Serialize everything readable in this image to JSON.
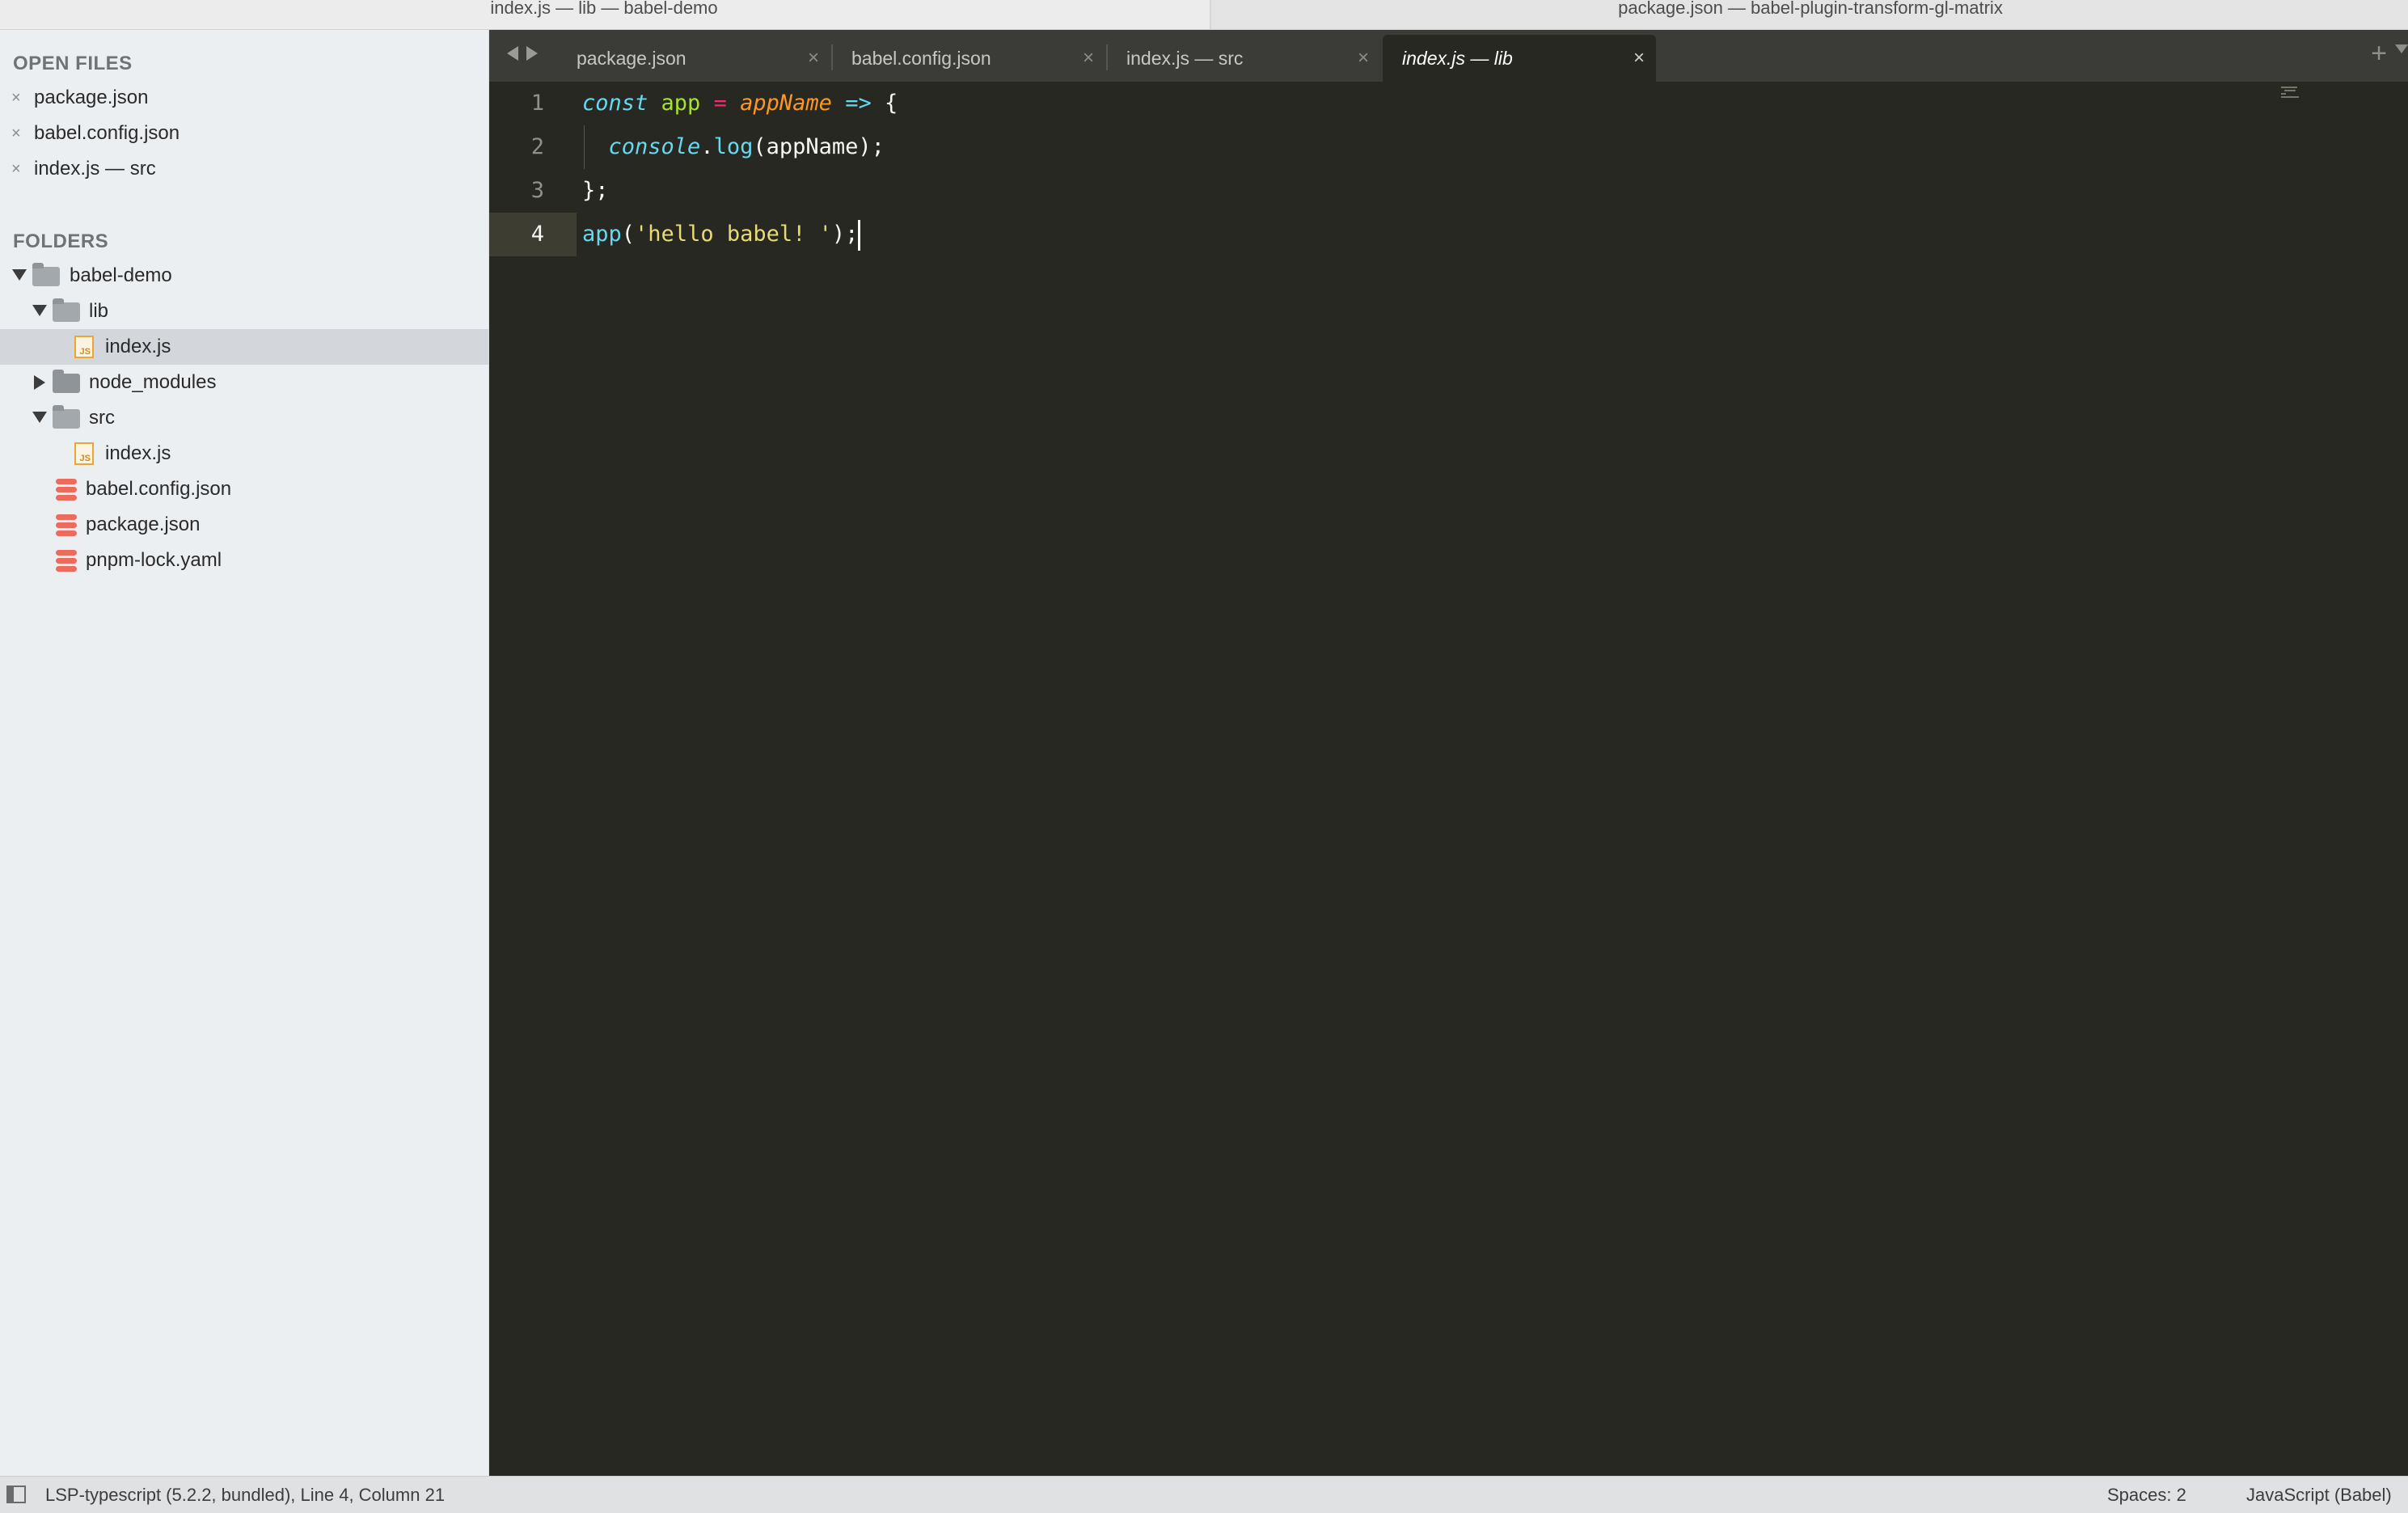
{
  "window": {
    "title_left": "index.js — lib — babel-demo",
    "title_right": "package.json — babel-plugin-transform-gl-matrix"
  },
  "sidebar": {
    "open_files_header": "OPEN FILES",
    "open_files": [
      {
        "label": "package.json",
        "close": "×"
      },
      {
        "label": "babel.config.json",
        "close": "×"
      },
      {
        "label": "index.js — src",
        "close": "×"
      }
    ],
    "folders_header": "FOLDERS",
    "tree": {
      "root": "babel-demo",
      "lib": "lib",
      "lib_index": "index.js",
      "node_modules": "node_modules",
      "src": "src",
      "src_index": "index.js",
      "babel_config": "babel.config.json",
      "package_json": "package.json",
      "pnpm_lock": "pnpm-lock.yaml"
    },
    "js_icon_text": "JS"
  },
  "tabs": [
    {
      "label": "package.json",
      "close": "×",
      "active": false
    },
    {
      "label": "babel.config.json",
      "close": "×",
      "active": false
    },
    {
      "label": "index.js — src",
      "close": "×",
      "active": false
    },
    {
      "label": "index.js — lib",
      "close": "×",
      "active": true
    }
  ],
  "tabbar": {
    "new_tab": "+"
  },
  "editor": {
    "line_numbers": [
      "1",
      "2",
      "3",
      "4"
    ],
    "current_line": 4,
    "lines": [
      [
        {
          "text": "const",
          "cls": "kw"
        },
        {
          "text": " ",
          "cls": ""
        },
        {
          "text": "app",
          "cls": "var"
        },
        {
          "text": " ",
          "cls": ""
        },
        {
          "text": "=",
          "cls": "op"
        },
        {
          "text": " ",
          "cls": ""
        },
        {
          "text": "appName",
          "cls": "param"
        },
        {
          "text": " ",
          "cls": ""
        },
        {
          "text": "=>",
          "cls": "kw"
        },
        {
          "text": " {",
          "cls": ""
        }
      ],
      [
        {
          "text": "  ",
          "cls": ""
        },
        {
          "text": "console",
          "cls": "builtin"
        },
        {
          "text": ".",
          "cls": ""
        },
        {
          "text": "log",
          "cls": "fn"
        },
        {
          "text": "(appName);",
          "cls": ""
        }
      ],
      [
        {
          "text": "};",
          "cls": ""
        }
      ],
      [
        {
          "text": "app",
          "cls": "fn"
        },
        {
          "text": "(",
          "cls": ""
        },
        {
          "text": "'hello babel! '",
          "cls": "str"
        },
        {
          "text": ");",
          "cls": ""
        }
      ]
    ]
  },
  "statusbar": {
    "left": "LSP-typescript (5.2.2, bundled), Line 4, Column 21",
    "spaces": "Spaces: 2",
    "syntax": "JavaScript (Babel)"
  },
  "colors": {
    "editor_bg": "#272822",
    "sidebar_bg": "#eceff1",
    "keyword": "#66d9ef",
    "variable": "#a6e22e",
    "operator": "#f92672",
    "parameter": "#fd971f",
    "string": "#e6db74"
  },
  "icons": [
    "folder-icon",
    "js-file-icon",
    "json-file-icon",
    "close-icon",
    "chevron-left-icon",
    "chevron-right-icon",
    "plus-icon",
    "sidebar-toggle-icon"
  ]
}
